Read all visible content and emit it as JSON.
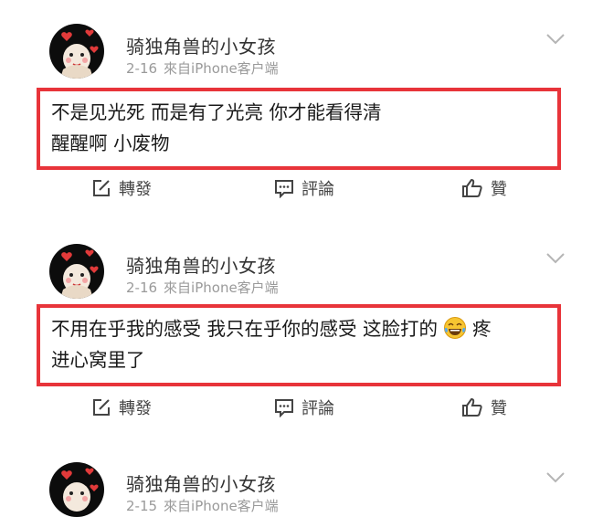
{
  "posts": [
    {
      "username": "骑独角兽的小女孩",
      "date": "2-16",
      "source": "來自iPhone客户端",
      "content_line1": "不是见光死 而是有了光亮 你才能看得清",
      "content_line2": "醒醒啊 小废物",
      "repost_label": "轉發",
      "comment_label": "評論",
      "like_label": "贊"
    },
    {
      "username": "骑独角兽的小女孩",
      "date": "2-16",
      "source": "來自iPhone客户端",
      "content_line1_a": "不用在乎我的感受 我只在乎你的感受 这脸打的",
      "content_line1_b": "疼",
      "content_line2": "进心窝里了",
      "emoji": "tears-of-joy-emoji",
      "repost_label": "轉發",
      "comment_label": "評論",
      "like_label": "贊"
    },
    {
      "username": "骑独角兽的小女孩",
      "date": "2-15",
      "source": "來自iPhone客户端"
    }
  ],
  "icons": {
    "repost": "edit-share-icon",
    "comment": "comment-bubble-icon",
    "like": "thumbs-up-icon",
    "more": "chevron-down-icon"
  },
  "colors": {
    "highlight_border": "#e8343a",
    "meta_text": "#9a9a9a"
  }
}
